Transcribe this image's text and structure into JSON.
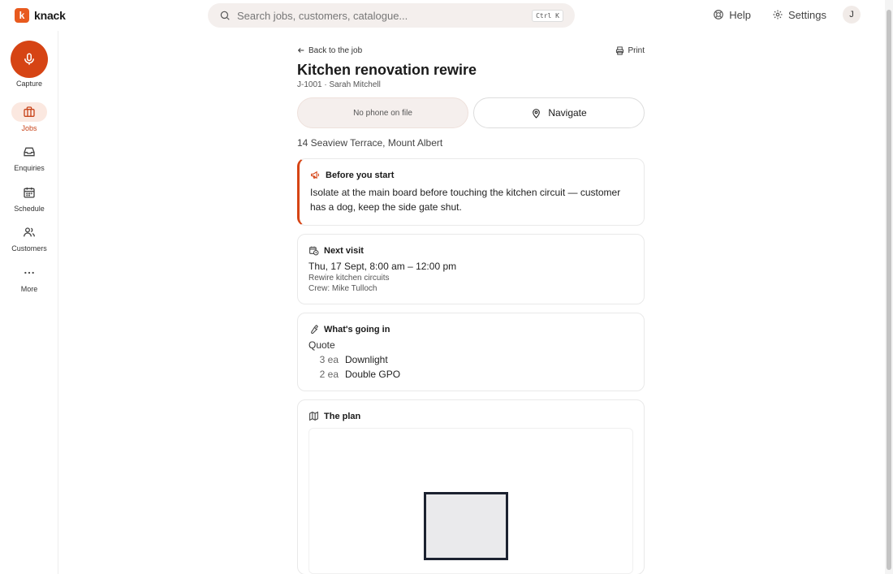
{
  "app": {
    "logo_letter": "k",
    "logo_text": "knack",
    "accent": "#d64414"
  },
  "search": {
    "placeholder": "Search jobs, customers, catalogue...",
    "shortcut": "Ctrl K"
  },
  "top_actions": {
    "help": "Help",
    "settings": "Settings",
    "avatar": "J"
  },
  "sidebar": {
    "capture_label": "Capture",
    "items": [
      {
        "label": "Jobs",
        "icon": "briefcase-icon",
        "active": true
      },
      {
        "label": "Enquiries",
        "icon": "inbox-icon",
        "active": false
      },
      {
        "label": "Schedule",
        "icon": "calendar-icon",
        "active": false
      },
      {
        "label": "Customers",
        "icon": "users-icon",
        "active": false
      },
      {
        "label": "More",
        "icon": "more-icon",
        "active": false
      }
    ]
  },
  "job": {
    "back_label": "Back to the job",
    "print_label": "Print",
    "title": "Kitchen renovation rewire",
    "subtitle": "J-1001 · Sarah Mitchell",
    "phone_button": "No phone on file",
    "navigate_button": "Navigate",
    "address": "14 Seaview Terrace, Mount Albert"
  },
  "before_start": {
    "heading": "Before you start",
    "text": "Isolate at the main board before touching the kitchen circuit — customer has a dog, keep the side gate shut."
  },
  "next_visit": {
    "heading": "Next visit",
    "when": "Thu, 17 Sept, 8:00 am – 12:00 pm",
    "description": "Rewire kitchen circuits",
    "crew": "Crew: Mike Tulloch"
  },
  "whats_going_in": {
    "heading": "What's going in",
    "group_label": "Quote",
    "items": [
      {
        "qty": "3 ea",
        "name": "Downlight"
      },
      {
        "qty": "2 ea",
        "name": "Double GPO"
      }
    ]
  },
  "plan": {
    "heading": "The plan"
  }
}
